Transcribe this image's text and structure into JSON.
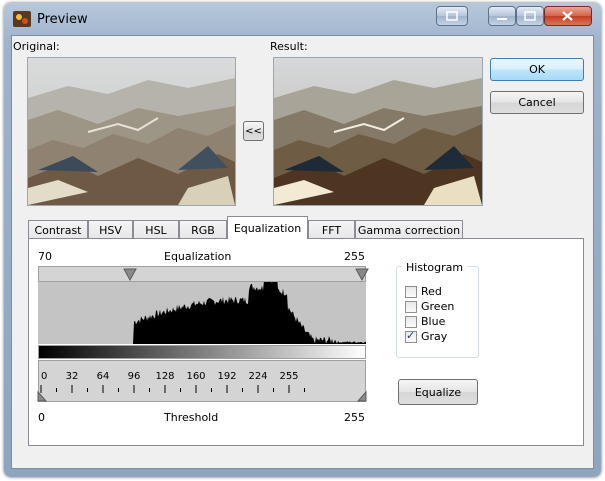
{
  "window": {
    "title": "Preview"
  },
  "labels": {
    "original": "Original:",
    "result": "Result:"
  },
  "buttons": {
    "ok": "OK",
    "cancel": "Cancel",
    "swap": "<<",
    "equalize": "Equalize"
  },
  "tabs": [
    "Contrast",
    "HSV",
    "HSL",
    "RGB",
    "Equalization",
    "FFT",
    "Gamma correction"
  ],
  "active_tab": "Equalization",
  "equalization": {
    "title": "Equalization",
    "range_min": "70",
    "range_max": "255",
    "ruler_ticks": [
      "0",
      "32",
      "64",
      "96",
      "128",
      "160",
      "192",
      "224",
      "255"
    ],
    "threshold_label": "Threshold",
    "threshold_min": "0",
    "threshold_max": "255"
  },
  "histogram": {
    "group_title": "Histogram",
    "channels": [
      {
        "label": "Red",
        "checked": false
      },
      {
        "label": "Green",
        "checked": false
      },
      {
        "label": "Blue",
        "checked": false
      },
      {
        "label": "Gray",
        "checked": true
      }
    ]
  },
  "colors": {
    "accent": "#3c7fb1",
    "histogram_fill": "#000000",
    "histogram_bg": "#c4c4c4"
  }
}
